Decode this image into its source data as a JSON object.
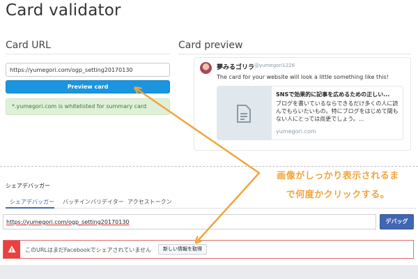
{
  "page": {
    "title": "Card validator"
  },
  "card_url": {
    "heading": "Card URL",
    "url_value": "https://yumegori.com/ogp_setting20170130",
    "preview_button": "Preview card",
    "whitelist_message": "*.yumegori.com is whitelisted for summary card"
  },
  "card_preview": {
    "heading": "Card preview",
    "tweet": {
      "name": "夢みるゴリラ",
      "handle": "@yumegori1228",
      "text": "The card for your website will look a little something like this!"
    },
    "card": {
      "title": "SNSで効果的に記事を広めるための正しい...",
      "description": "ブログを書いているならできるだけ多くの人に読んでもらいたいもの。特にブログをはじめて間もない人にとっては尚更でしょう。...",
      "domain": "yumegori.com",
      "thumbnail_icon": "document-icon"
    }
  },
  "facebook": {
    "section_title": "シェアデバッガー",
    "tabs": [
      {
        "label": "シェアデバッガー",
        "active": true
      },
      {
        "label": "バッチインバリデイター",
        "active": false
      },
      {
        "label": "アクセストークン",
        "active": false
      }
    ],
    "url_value": "https://yumegori.com/ogp_setting20170130",
    "debug_button": "デバッグ",
    "alert": {
      "icon": "warning-icon",
      "message": "このURLはまだFacebookでシェアされていません",
      "button": "新しい情報を取得"
    }
  },
  "annotation": {
    "line1": "画像がしっかり表示されるま",
    "line2": "で何度かクリックする。",
    "color": "#f2a43a"
  },
  "colors": {
    "twitter_blue": "#1b95e0",
    "success_bg": "#dff0d8",
    "success_text": "#3c763d",
    "facebook_blue": "#4267b2",
    "alert_red": "#e8413f"
  }
}
